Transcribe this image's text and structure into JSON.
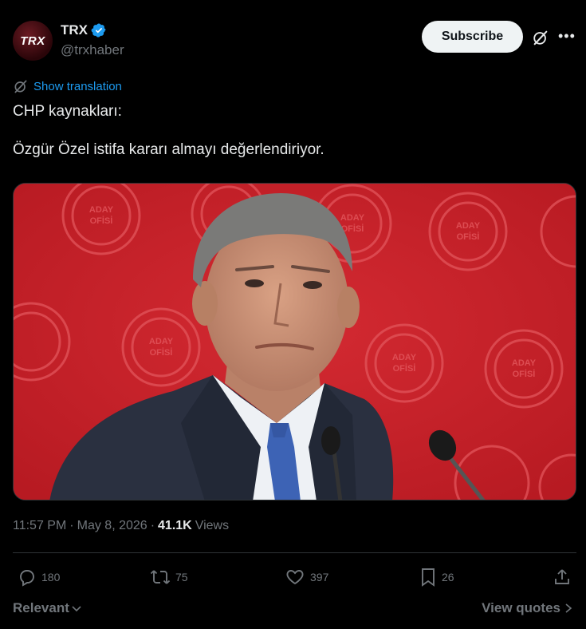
{
  "author": {
    "avatar_text": "TRX",
    "name": "TRX",
    "handle": "@trxhaber",
    "verified_icon": "verified-badge-icon"
  },
  "header": {
    "subscribe_label": "Subscribe",
    "grok_icon": "grok-icon",
    "more_icon": "more-icon"
  },
  "translate": {
    "label": "Show translation"
  },
  "tweet": {
    "text": "CHP kaynakları:\n\nÖzgür Özel istifa kararı almayı değerlendiriyor."
  },
  "media": {
    "seal_text": [
      "ADAY",
      "OFİSİ"
    ],
    "background_color": "#c8202a"
  },
  "meta": {
    "time": "11:57 PM",
    "date": "May 8, 2026",
    "views_count": "41.1K",
    "views_label": "Views"
  },
  "actions": {
    "replies": "180",
    "reposts": "75",
    "likes": "397",
    "bookmarks": "26"
  },
  "footer": {
    "sort_label": "Relevant",
    "quotes_label": "View quotes"
  },
  "colors": {
    "accent": "#1d9bf0",
    "text": "#e7e9ea",
    "muted": "#71767b",
    "background": "#000000"
  }
}
